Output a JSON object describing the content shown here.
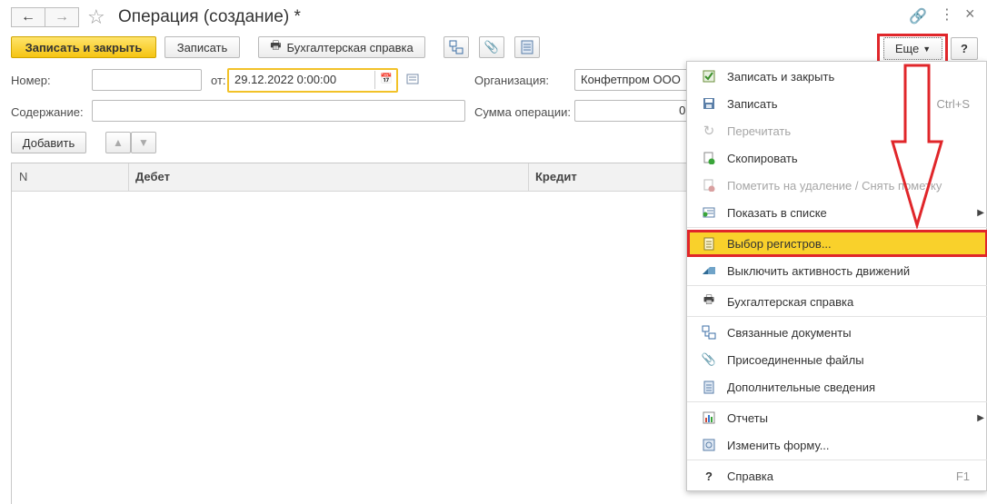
{
  "window": {
    "title": "Операция (создание) *"
  },
  "toolbar": {
    "save_close": "Записать и закрыть",
    "save": "Записать",
    "report": "Бухгалтерская справка",
    "more": "Еще",
    "help": "?"
  },
  "form": {
    "number_label": "Номер:",
    "number_value": "",
    "date_label": "от:",
    "date_value": "29.12.2022  0:00:00",
    "org_label": "Организация:",
    "org_value": "Конфетпром ООО",
    "content_label": "Содержание:",
    "content_value": "",
    "sum_label": "Сумма операции:",
    "sum_value": "0,"
  },
  "table": {
    "add_button": "Добавить",
    "columns": [
      "N",
      "Дебет",
      "Кредит"
    ]
  },
  "menu": {
    "items": [
      {
        "label": "Записать и закрыть",
        "shortcut": "",
        "icon": "save-close-icon",
        "disabled": false
      },
      {
        "label": "Записать",
        "shortcut": "Ctrl+S",
        "icon": "floppy-icon",
        "disabled": false
      },
      {
        "label": "Перечитать",
        "shortcut": "",
        "icon": "refresh-icon",
        "disabled": true
      },
      {
        "label": "Скопировать",
        "shortcut": "",
        "icon": "copy-icon",
        "disabled": false
      },
      {
        "label": "Пометить на удаление / Снять пометку",
        "shortcut": "",
        "icon": "delete-mark-icon",
        "disabled": true
      },
      {
        "label": "Показать в списке",
        "shortcut": "",
        "icon": "show-in-list-icon",
        "disabled": false
      },
      {
        "label": "Выбор регистров...",
        "shortcut": "",
        "icon": "registers-icon",
        "disabled": false
      },
      {
        "label": "Выключить активность движений",
        "shortcut": "",
        "icon": "activity-off-icon",
        "disabled": false
      },
      {
        "label": "Бухгалтерская справка",
        "shortcut": "",
        "icon": "printer-icon",
        "disabled": false
      },
      {
        "label": "Связанные документы",
        "shortcut": "",
        "icon": "linked-docs-icon",
        "disabled": false
      },
      {
        "label": "Присоединенные файлы",
        "shortcut": "",
        "icon": "paperclip-icon",
        "disabled": false
      },
      {
        "label": "Дополнительные сведения",
        "shortcut": "",
        "icon": "info-list-icon",
        "disabled": false
      },
      {
        "label": "Отчеты",
        "shortcut": "",
        "icon": "reports-icon",
        "disabled": false
      },
      {
        "label": "Изменить форму...",
        "shortcut": "",
        "icon": "change-form-icon",
        "disabled": false
      },
      {
        "label": "Справка",
        "shortcut": "F1",
        "icon": "help-icon",
        "disabled": false
      }
    ]
  },
  "colors": {
    "highlight": "#f9d12b",
    "annotation_red": "#e0262a",
    "primary_button": "#f5c412"
  }
}
